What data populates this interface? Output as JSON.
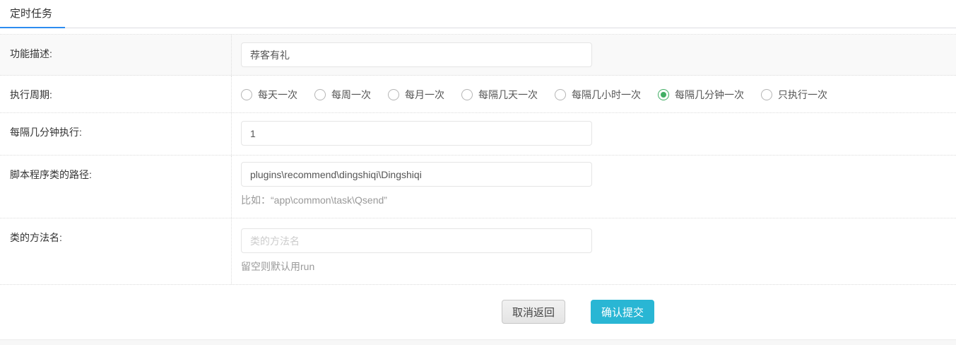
{
  "tab": {
    "label": "定时任务"
  },
  "form": {
    "rows": [
      {
        "label": "功能描述:",
        "type": "input",
        "value": "荐客有礼",
        "placeholder": ""
      },
      {
        "label": "执行周期:",
        "type": "radio-group",
        "options": [
          "每天一次",
          "每周一次",
          "每月一次",
          "每隔几天一次",
          "每隔几小时一次",
          "每隔几分钟一次",
          "只执行一次"
        ],
        "selected_index": 5,
        "selected": "每隔几分钟一次"
      },
      {
        "label": "每隔几分钟执行:",
        "type": "input",
        "value": "1",
        "placeholder": ""
      },
      {
        "label": "脚本程序类的路径:",
        "type": "input",
        "value": "plugins\\recommend\\dingshiqi\\Dingshiqi",
        "placeholder": "",
        "hint": "比如：“app\\common\\task\\Qsend”"
      },
      {
        "label": "类的方法名:",
        "type": "input",
        "value": "",
        "placeholder": "类的方法名",
        "hint": "留空则默认用run"
      }
    ],
    "buttons": {
      "cancel": "取消返回",
      "submit": "确认提交"
    }
  },
  "colors": {
    "accent-blue": "#2d8cf0",
    "radio-green": "#41ae64",
    "submit-cyan": "#29b6d4"
  }
}
